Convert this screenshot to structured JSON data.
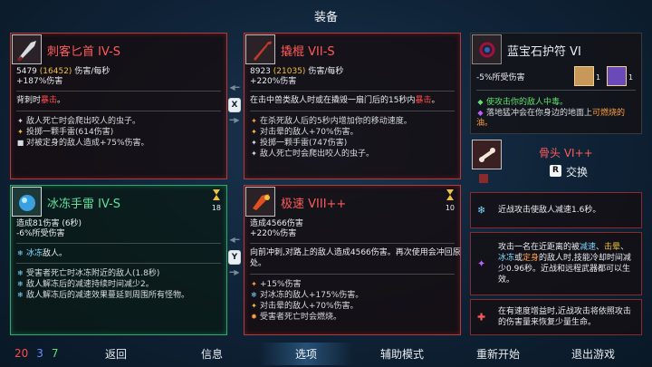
{
  "header": {
    "title": "装备"
  },
  "cards": {
    "dagger": {
      "name": "刺客匕首 IV-S",
      "dps_main": "5479",
      "dps_alt": "(16452)",
      "dps_unit": "伤害/每秒",
      "bonus": "+187%伤害",
      "desc_a": "背刺时",
      "desc_b": "暴击",
      "desc_c": "。",
      "lines": [
        "敌人死亡时会爬出咬人的虫子。",
        "投掷一颗手雷(614伤害)",
        "对被定身的敌人造成+75%伤害。"
      ]
    },
    "crowbar": {
      "name": "撬棍 VII-S",
      "dps_main": "8923",
      "dps_alt": "(21035)",
      "dps_unit": "伤害/每秒",
      "bonus": "+220%伤害",
      "desc_a": "在击中兽类敌人时或在撬毁一扇门后的15秒内",
      "desc_b": "暴击",
      "desc_c": "。",
      "lines": [
        "在杀死敌人后的5秒内增加你的移动速度。",
        "对击晕的敌人+70%伤害。",
        "投掷一颗手雷(747伤害)",
        "敌人死亡时会爬出咬人的虫子。"
      ]
    },
    "freeze": {
      "name": "冰冻手雷 IV-S",
      "level": "18",
      "line1": "造成81伤害 (6秒)",
      "line2": "-6%所受伤害",
      "desc_a": "冰冻",
      "desc_b": "敌人。",
      "lines": [
        "受害者死亡时冰冻附近的敌人(1.8秒)",
        "敌人解冻后的减速持续时间减少2。",
        "敌人解冻后的减速效果蔓延到周围所有怪物。"
      ]
    },
    "speed": {
      "name": "极速 VIII++",
      "level": "10",
      "line1": "造成4566伤害",
      "line2": "+220%伤害",
      "desc_1": "向前冲刺,对路上的敌人造成4566伤害。再次使用会冲回原",
      "desc_2": "处。",
      "lines": [
        "+15%伤害",
        "对冰冻的敌人+175%伤害。",
        "对击晕的敌人+70%伤害。",
        "受害者死亡时会燃烧。"
      ]
    },
    "amulet": {
      "name": "蓝宝石护符 VI",
      "slot1": "1",
      "slot2": "1",
      "line1": "-5%所受伤害",
      "desc_1": "使攻击你的敌人中毒。",
      "desc_2a": "落地猛冲会在你身边的地面上",
      "desc_2b": "可燃烧的",
      "desc_3": "油。"
    },
    "bone": {
      "name": "骨头 VI++",
      "swap_key": "R",
      "swap_label": "交换",
      "hint1": "近战攻击使敌人减速1.6秒。",
      "hint2_a": "攻击一名在近距离的被",
      "hint2_b": "减速",
      "hint2_c": "、",
      "hint2_d": "击晕",
      "hint2_e": "、",
      "hint2_f": "冰冻",
      "hint2_g": "或",
      "hint2_h": "定身",
      "hint2_i": "的敌人时,技能冷却时间减少0.96秒。近战和远程武器都可以生效。",
      "hint3": "在有速度增益时,近战攻击将依照攻击的伤害量来恢复少量生命。"
    }
  },
  "swap_keys": {
    "x": "X",
    "y": "Y"
  },
  "stats": {
    "red": "20",
    "blue": "3",
    "green": "7"
  },
  "colors": {
    "red": "#ff4a4a",
    "blue": "#6a8cff",
    "green": "#5ee070"
  },
  "menu": [
    "返回",
    "信息",
    "选项",
    "辅助模式",
    "重新开始",
    "退出游戏"
  ],
  "menu_active": "选项"
}
